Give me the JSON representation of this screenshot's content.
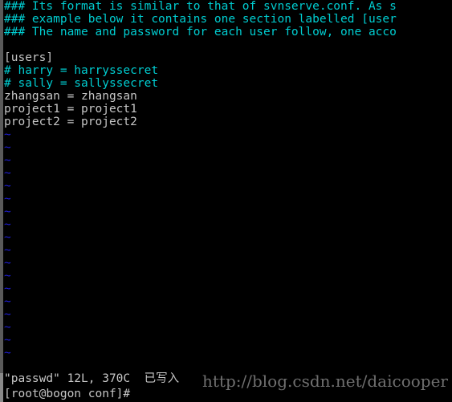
{
  "terminal": {
    "background_color": "#000000",
    "foreground_color": "#c6c6c6",
    "comment_color": "#00cdd1",
    "tilde_color": "#1f1fd6",
    "scrollbar_color": "#8a8a8a"
  },
  "editor": {
    "name": "vim",
    "filename": "passwd",
    "lines": [
      {
        "text": "### Its format is similar to that of svnserve.conf. As s",
        "style": "comment"
      },
      {
        "text": "### example below it contains one section labelled [user",
        "style": "comment"
      },
      {
        "text": "### The name and password for each user follow, one acco",
        "style": "comment"
      },
      {
        "text": "",
        "style": "text"
      },
      {
        "text": "[users]",
        "style": "text"
      },
      {
        "text": "# harry = harryssecret",
        "style": "comment"
      },
      {
        "text": "# sally = sallyssecret",
        "style": "comment"
      },
      {
        "text": "zhangsan = zhangsan",
        "style": "text"
      },
      {
        "text": "project1 = project1",
        "style": "text"
      },
      {
        "text": "project2 = project2",
        "style": "text"
      }
    ],
    "empty_marker": "~",
    "empty_marker_count": 18
  },
  "status": {
    "file_label": "\"passwd\"",
    "line_count": "12L",
    "separator": ",",
    "char_count": "370C",
    "write_message": "已写入",
    "full_text": "\"passwd\" 12L, 370C 已写入"
  },
  "prompt": {
    "user": "root",
    "host": "bogon",
    "directory": "conf",
    "symbol": "#",
    "full_text": "[root@bogon conf]#"
  },
  "watermark": {
    "text": "http://blog.csdn.net/daicooper"
  }
}
